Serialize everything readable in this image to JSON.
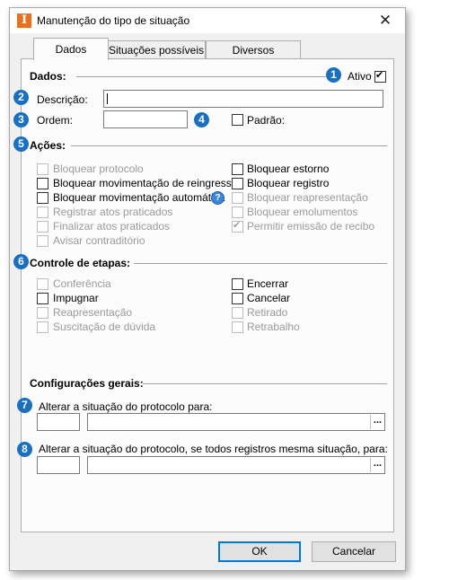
{
  "window": {
    "title": "Manutenção do tipo de situação",
    "app_icon_letter": "I",
    "close_glyph": "✕"
  },
  "tabs": [
    {
      "label": "Dados",
      "active": true
    },
    {
      "label": "Situações possíveis",
      "active": false
    },
    {
      "label": "Diversos",
      "active": false
    }
  ],
  "badges": [
    "1",
    "2",
    "3",
    "4",
    "5",
    "6",
    "7",
    "8"
  ],
  "dados": {
    "section_label": "Dados:",
    "ativo_label": "Ativo",
    "ativo_checked": true,
    "descricao_label": "Descrição:",
    "descricao_value": "",
    "ordem_label": "Ordem:",
    "ordem_value": "",
    "padrao_label": "Padrão:",
    "padrao_checked": false
  },
  "acoes": {
    "section_label": "Ações:",
    "help_glyph": "?",
    "left": [
      {
        "label": "Bloquear protocolo",
        "enabled": false,
        "checked": false
      },
      {
        "label": "Bloquear movimentação de reingresso",
        "enabled": true,
        "checked": false
      },
      {
        "label": "Bloquear movimentação automática",
        "enabled": true,
        "checked": false
      },
      {
        "label": "Registrar atos praticados",
        "enabled": false,
        "checked": false
      },
      {
        "label": "Finalizar atos praticados",
        "enabled": false,
        "checked": false
      },
      {
        "label": "Avisar contraditório",
        "enabled": false,
        "checked": false
      }
    ],
    "right": [
      {
        "label": "Bloquear estorno",
        "enabled": true,
        "checked": false
      },
      {
        "label": "Bloquear registro",
        "enabled": true,
        "checked": false
      },
      {
        "label": "Bloquear reapresentação",
        "enabled": false,
        "checked": false
      },
      {
        "label": "Bloquear emolumentos",
        "enabled": false,
        "checked": false
      },
      {
        "label": "Permitir emissão de recibo",
        "enabled": false,
        "checked": true
      }
    ]
  },
  "controle": {
    "section_label": "Controle de etapas:",
    "left": [
      {
        "label": "Conferência",
        "enabled": false,
        "checked": false
      },
      {
        "label": "Impugnar",
        "enabled": true,
        "checked": false
      },
      {
        "label": "Reapresentação",
        "enabled": false,
        "checked": false
      },
      {
        "label": "Suscitação de dúvida",
        "enabled": false,
        "checked": false
      }
    ],
    "right": [
      {
        "label": "Encerrar",
        "enabled": true,
        "checked": false
      },
      {
        "label": "Cancelar",
        "enabled": true,
        "checked": false
      },
      {
        "label": "Retirado",
        "enabled": false,
        "checked": false
      },
      {
        "label": "Retrabalho",
        "enabled": false,
        "checked": false
      }
    ]
  },
  "config": {
    "section_label": "Configurações gerais:",
    "alterar_label": "Alterar a situação do protocolo para:",
    "alterar_code": "",
    "alterar_desc": "",
    "alterar_todos_label": "Alterar a situação do protocolo, se todos registros mesma situação, para:",
    "alterar_todos_code": "",
    "alterar_todos_desc": "",
    "lookup_glyph": "..."
  },
  "buttons": {
    "ok_label": "OK",
    "cancel_label": "Cancelar"
  }
}
